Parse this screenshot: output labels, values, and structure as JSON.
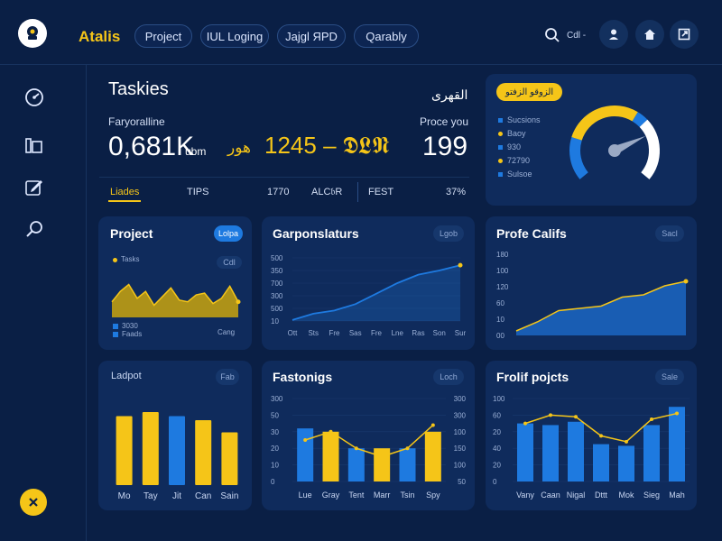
{
  "app": {
    "name": "Atalis"
  },
  "header": {
    "nav": [
      "Project",
      "IUL Loging",
      "Jajgl ЯPD",
      "Qarably"
    ],
    "search_label": "Cdl -"
  },
  "summary": {
    "title": "Taskies",
    "subtitle_right": "القهرى",
    "metric1_label": "Faryoralline",
    "metric1_value": "0,681K",
    "metric1_unit": "ubm",
    "metric2_value": "1245 – 𝕯𝕷𝕹",
    "metric2_prefix": "هور",
    "metric3_label": "Proce you",
    "metric3_value": "199",
    "footer": [
      "Liades",
      "TIPS",
      "1770",
      "ALC𝔟R",
      "FEST",
      "37%"
    ]
  },
  "gauge_card": {
    "tag": "الزوقو الزفتو",
    "legend": [
      "Sucsions",
      "Baoy",
      "930",
      "72790",
      "Sulsoe"
    ],
    "legend_colors": [
      "#1e7ae0",
      "#f5c518",
      "#1e7ae0",
      "#f5c518",
      "#1e7ae0"
    ],
    "gauge_value_fraction": 0.75
  },
  "cards": {
    "project": {
      "title": "Project",
      "chip": "Lolpa",
      "series_label": "Tasks",
      "chip2": "Cdl",
      "legend": [
        "3030",
        "Faads"
      ],
      "footer": "Cang"
    },
    "garp": {
      "title": "Garponslaturs",
      "chip": "Lgob"
    },
    "profe": {
      "title": "Profe Califs",
      "chip": "Sacl"
    },
    "lapot": {
      "title": "Ladpot",
      "chip": "Fab"
    },
    "fastonigs": {
      "title": "Fastonigs",
      "chip": "Loch"
    },
    "frolif": {
      "title": "Frolif pojcts",
      "chip": "Sale"
    }
  },
  "chart_data": [
    {
      "type": "area",
      "title": "Project",
      "x": [
        0,
        1,
        2,
        3,
        4,
        5,
        6,
        7,
        8,
        9,
        10,
        11,
        12,
        13,
        14,
        15
      ],
      "y": [
        18,
        30,
        38,
        22,
        30,
        14,
        24,
        34,
        20,
        18,
        26,
        28,
        16,
        22,
        36,
        18
      ],
      "ylim": [
        0,
        50
      ],
      "colors": [
        "#c9a40d"
      ]
    },
    {
      "type": "line",
      "title": "Garponslaturs",
      "categories": [
        "Ott",
        "Sts",
        "Fre",
        "Sas",
        "Fre",
        "Lne",
        "Ras",
        "Son",
        "Sur"
      ],
      "values": [
        10,
        70,
        100,
        160,
        260,
        360,
        440,
        480,
        530
      ],
      "ytick_labels": [
        "500",
        "350",
        "700",
        "300",
        "500",
        "10"
      ],
      "ylim": [
        0,
        600
      ],
      "colors": [
        "#1e7ae0"
      ]
    },
    {
      "type": "area",
      "title": "Profe Califs",
      "values": [
        10,
        30,
        55,
        60,
        65,
        85,
        90,
        110,
        120
      ],
      "ytick_labels": [
        "180",
        "100",
        "120",
        "60",
        "10",
        "00"
      ],
      "ylim": [
        0,
        180
      ],
      "colors": [
        "#1e6fd0"
      ]
    },
    {
      "type": "bar",
      "title": "Ladpot",
      "categories": [
        "Mo",
        "Tay",
        "Jit",
        "Can",
        "Sain"
      ],
      "values": [
        85,
        90,
        85,
        80,
        65
      ],
      "colors": [
        "#f5c518",
        "#f5c518",
        "#1e7ae0",
        "#f5c518",
        "#f5c518"
      ],
      "ylim": [
        0,
        100
      ]
    },
    {
      "type": "bar",
      "title": "Fastonigs",
      "categories": [
        "Lue",
        "Gray",
        "Tent",
        "Marr",
        "Tsin",
        "Spy"
      ],
      "series": [
        {
          "values": [
            32,
            30,
            20,
            20,
            20,
            30
          ]
        },
        {
          "values": [
            25,
            28,
            15,
            18,
            18,
            34
          ]
        }
      ],
      "bar_values": [
        32,
        30,
        20,
        20,
        20,
        30
      ],
      "bar_colors": [
        "#1e7ae0",
        "#f5c518",
        "#1e7ae0",
        "#f5c518",
        "#1e7ae0",
        "#f5c518"
      ],
      "line_values": [
        25,
        30,
        20,
        15,
        20,
        34
      ],
      "ytick_labels": [
        "300",
        "50",
        "30",
        "20",
        "10",
        "0"
      ],
      "ytick_labels_right": [
        "300",
        "300",
        "100",
        "150",
        "100",
        "50"
      ],
      "ylim": [
        0,
        50
      ]
    },
    {
      "type": "bar",
      "title": "Frolif pojcts",
      "categories": [
        "Vany",
        "Caan",
        "Nigal",
        "Dttt",
        "Mok",
        "Sieg",
        "Mah"
      ],
      "bar_values": [
        70,
        68,
        72,
        45,
        43,
        68,
        90
      ],
      "line_values": [
        70,
        80,
        78,
        55,
        48,
        75,
        82
      ],
      "ytick_labels": [
        "100",
        "60",
        "20",
        "40",
        "20",
        "0"
      ],
      "ylim": [
        0,
        100
      ],
      "colors": [
        "#1e7ae0",
        "#f5c518"
      ]
    }
  ]
}
